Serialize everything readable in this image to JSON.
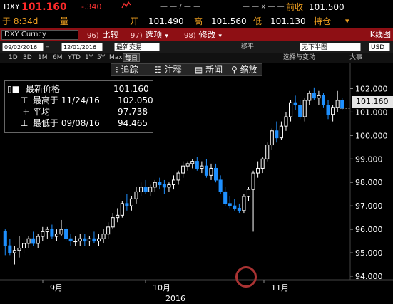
{
  "quote": {
    "ticker": "DXY",
    "last": "101.160",
    "change": "-.340",
    "dashes_a": "— — / — —",
    "dashes_b": "— — x — —",
    "prev_label": "前收",
    "prev_value": "101.500",
    "time": "于 8:34d",
    "volume_label": "量",
    "open_label": "开",
    "open_value": "101.490",
    "high_label": "高",
    "high_value": "101.560",
    "low_label": "低",
    "low_value": "101.130",
    "position_label": "持仓"
  },
  "menubar": {
    "security_field": "DXY Curncy",
    "compare_num": "96)",
    "compare_label": "比较",
    "options_num": "97)",
    "options_label": "选项",
    "edit_num": "98)",
    "edit_label": "修改",
    "right_label": "K线图"
  },
  "daterow": {
    "start_date": "09/02/2016",
    "end_date": "12/01/2016",
    "period_select": "最新交易",
    "type_label": "移平",
    "overlay_select": "无下半图",
    "currency_select": "USD"
  },
  "ranges": {
    "items": [
      "1D",
      "3D",
      "1M",
      "6M",
      "YTD",
      "1Y",
      "5Y",
      "Max"
    ],
    "active": "每日",
    "pos_label": "选择与变动",
    "size_label": "大事"
  },
  "chart_toolbar": {
    "track_label": "追踪",
    "annotate_label": "注释",
    "news_label": "新闻",
    "zoom_label": "缩放"
  },
  "legend": {
    "last_label": "最新价格",
    "last_value": "101.160",
    "high_label": "最高于 11/24/16",
    "high_value": "102.050",
    "avg_label": "平均",
    "avg_value": "97.738",
    "low_label": "最低于 09/08/16",
    "low_value": "94.465"
  },
  "chart_data": {
    "type": "candlestick",
    "ylim": [
      94,
      102.5
    ],
    "y_ticks": [
      "94.000",
      "95.000",
      "96.000",
      "97.000",
      "98.000",
      "99.000",
      "100.000",
      "101.000",
      "102.000"
    ],
    "x_labels": [
      "9月",
      "10月",
      "11月"
    ],
    "year_label": "2016",
    "last_price": "101.160",
    "up_color": "#ffffff",
    "down_color": "#1e90ff",
    "candles": [
      [
        95.9,
        96.0,
        94.9,
        95.3
      ],
      [
        95.3,
        95.6,
        94.9,
        95.0
      ],
      [
        95.0,
        95.3,
        94.5,
        95.1
      ],
      [
        95.1,
        95.7,
        94.8,
        95.2
      ],
      [
        95.2,
        95.6,
        95.0,
        95.4
      ],
      [
        95.4,
        95.7,
        95.2,
        95.6
      ],
      [
        95.6,
        95.9,
        95.3,
        95.4
      ],
      [
        95.4,
        95.8,
        95.2,
        95.7
      ],
      [
        95.7,
        96.1,
        95.5,
        95.9
      ],
      [
        95.9,
        96.1,
        95.6,
        96.0
      ],
      [
        96.0,
        96.2,
        95.6,
        95.7
      ],
      [
        95.7,
        96.0,
        95.5,
        95.8
      ],
      [
        95.8,
        96.4,
        95.7,
        96.0
      ],
      [
        96.0,
        96.1,
        95.5,
        95.6
      ],
      [
        95.6,
        95.8,
        95.3,
        95.5
      ],
      [
        95.5,
        95.7,
        95.3,
        95.5
      ],
      [
        95.5,
        95.8,
        95.3,
        95.6
      ],
      [
        95.6,
        95.8,
        95.3,
        95.5
      ],
      [
        95.5,
        95.7,
        95.3,
        95.6
      ],
      [
        95.6,
        95.9,
        95.4,
        95.5
      ],
      [
        95.5,
        95.8,
        95.3,
        95.6
      ],
      [
        95.6,
        96.0,
        95.4,
        95.8
      ],
      [
        95.8,
        96.3,
        95.6,
        96.1
      ],
      [
        96.1,
        96.7,
        96.0,
        96.5
      ],
      [
        96.5,
        96.9,
        96.3,
        96.6
      ],
      [
        96.6,
        97.2,
        96.5,
        97.1
      ],
      [
        97.1,
        97.5,
        96.8,
        97.0
      ],
      [
        97.0,
        97.4,
        96.8,
        97.3
      ],
      [
        97.3,
        97.8,
        97.1,
        97.6
      ],
      [
        97.6,
        98.0,
        97.4,
        97.8
      ],
      [
        97.8,
        98.1,
        97.5,
        97.6
      ],
      [
        97.6,
        97.9,
        97.4,
        97.8
      ],
      [
        97.8,
        98.1,
        97.6,
        98.0
      ],
      [
        98.0,
        98.2,
        97.7,
        97.9
      ],
      [
        97.9,
        98.1,
        97.5,
        97.8
      ],
      [
        97.8,
        98.0,
        97.6,
        97.9
      ],
      [
        97.9,
        98.3,
        97.7,
        98.1
      ],
      [
        98.1,
        98.5,
        97.9,
        98.4
      ],
      [
        98.4,
        98.9,
        98.2,
        98.7
      ],
      [
        98.7,
        98.9,
        98.5,
        98.8
      ],
      [
        98.8,
        99.0,
        98.6,
        98.9
      ],
      [
        98.9,
        99.1,
        98.5,
        98.6
      ],
      [
        98.6,
        98.9,
        98.4,
        98.7
      ],
      [
        98.7,
        99.0,
        98.2,
        98.3
      ],
      [
        98.3,
        98.8,
        98.1,
        98.6
      ],
      [
        98.6,
        98.8,
        98.0,
        98.1
      ],
      [
        98.1,
        98.3,
        97.5,
        97.6
      ],
      [
        97.6,
        97.8,
        97.0,
        97.1
      ],
      [
        97.1,
        97.4,
        96.9,
        97.0
      ],
      [
        97.0,
        97.3,
        96.8,
        96.9
      ],
      [
        96.9,
        97.1,
        96.7,
        96.8
      ],
      [
        96.8,
        97.5,
        96.7,
        97.4
      ],
      [
        97.4,
        97.8,
        97.2,
        97.7
      ],
      [
        97.7,
        98.5,
        95.9,
        98.4
      ],
      [
        98.4,
        98.9,
        98.2,
        98.6
      ],
      [
        98.6,
        99.1,
        98.4,
        99.0
      ],
      [
        99.0,
        99.7,
        98.9,
        99.6
      ],
      [
        99.6,
        100.3,
        99.4,
        100.2
      ],
      [
        100.2,
        100.6,
        99.7,
        99.9
      ],
      [
        99.9,
        100.6,
        99.8,
        100.4
      ],
      [
        100.4,
        101.0,
        100.2,
        100.8
      ],
      [
        100.8,
        101.5,
        100.6,
        101.4
      ],
      [
        101.4,
        101.7,
        101.1,
        101.3
      ],
      [
        101.3,
        101.5,
        100.7,
        100.8
      ],
      [
        100.8,
        101.6,
        100.6,
        101.5
      ],
      [
        101.5,
        101.9,
        101.3,
        101.8
      ],
      [
        101.8,
        102.05,
        101.5,
        101.6
      ],
      [
        101.6,
        101.9,
        101.3,
        101.7
      ],
      [
        101.7,
        101.8,
        101.2,
        101.3
      ],
      [
        101.3,
        101.5,
        100.7,
        100.9
      ],
      [
        100.9,
        101.3,
        100.6,
        101.2
      ],
      [
        101.2,
        101.9,
        101.0,
        101.5
      ],
      [
        101.5,
        101.6,
        101.1,
        101.16
      ]
    ]
  }
}
